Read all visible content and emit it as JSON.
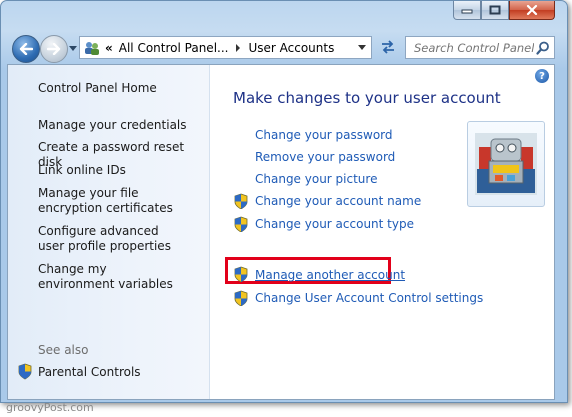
{
  "window": {
    "minimize_glyph": "—",
    "maximize_glyph": "☐",
    "close_glyph": "✕"
  },
  "nav": {
    "address_chevrons": "«",
    "breadcrumb": [
      "All Control Panel...",
      "User Accounts"
    ],
    "search_placeholder": "Search Control Panel"
  },
  "sidebar": {
    "home": "Control Panel Home",
    "links": [
      "Manage your credentials",
      "Create a password reset disk",
      "Link online IDs",
      "Manage your file encryption certificates",
      "Configure advanced user profile properties",
      "Change my environment variables"
    ],
    "see_also_label": "See also",
    "see_also_links": [
      "Parental Controls"
    ]
  },
  "main": {
    "title": "Make changes to your user account",
    "tasks": [
      {
        "label": "Change your password",
        "shield": false
      },
      {
        "label": "Remove your password",
        "shield": false
      },
      {
        "label": "Change your picture",
        "shield": false
      },
      {
        "label": "Change your account name",
        "shield": true
      },
      {
        "label": "Change your account type",
        "shield": true
      }
    ],
    "other_tasks": [
      {
        "label": "Manage another account",
        "shield": true,
        "highlighted": true
      },
      {
        "label": "Change User Account Control settings",
        "shield": true
      }
    ],
    "help_glyph": "?"
  },
  "watermark": "groovyPost.com",
  "colors": {
    "link": "#1f5bb6",
    "title": "#1e3287",
    "highlight_box": "#e2001a",
    "chrome": "#bcd6ef"
  },
  "icons": {
    "back": "back-arrow-icon",
    "forward": "forward-arrow-icon",
    "user_accounts": "user-accounts-icon",
    "refresh": "refresh-icon",
    "search": "search-icon",
    "shield": "uac-shield-icon",
    "avatar": "robot-avatar-icon"
  }
}
